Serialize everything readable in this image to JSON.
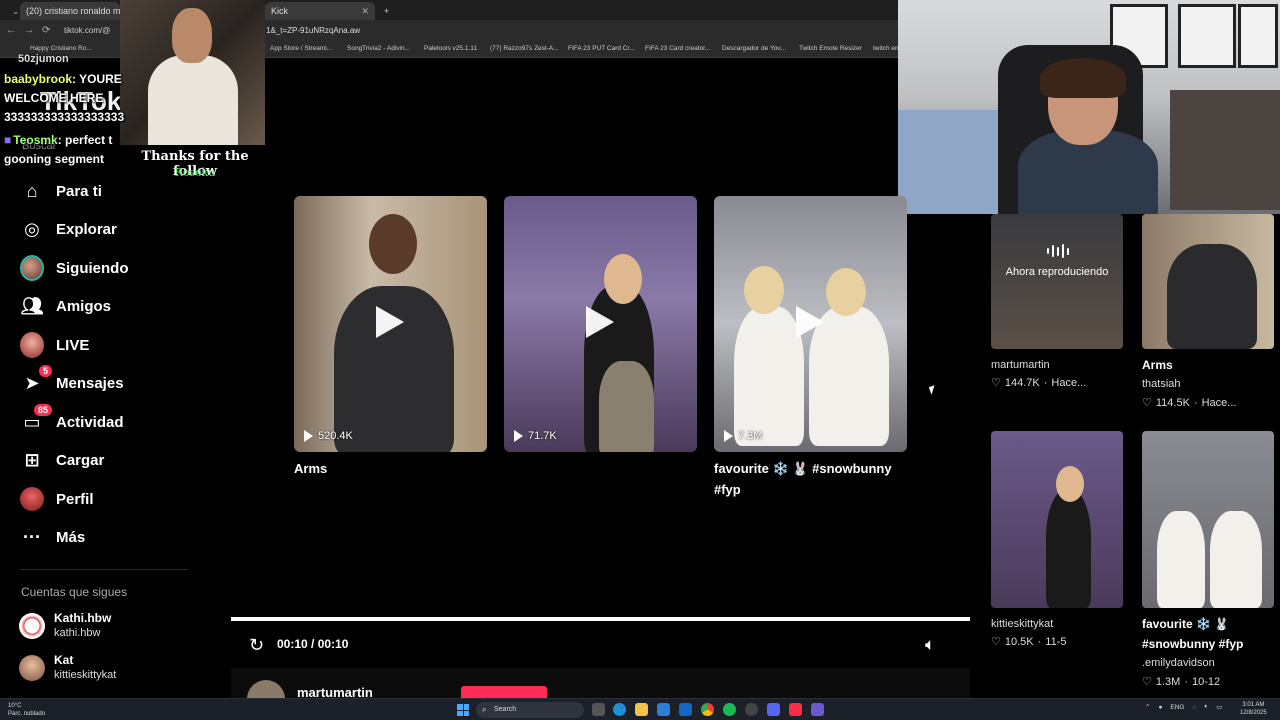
{
  "browser": {
    "tabs": [
      {
        "label": "(20) cristiano ronaldo mexico",
        "active": true
      },
      {
        "label": "Kick",
        "active": false
      }
    ],
    "url_short": "tiktok.com/@",
    "url_tail": "1&_t=ZP-91uNRzqAna.aw",
    "bookmarks": [
      "Happy Cristiano Ro...",
      "App Store / Streami...",
      "SongTrivia2 - Adivin...",
      "Paletools v25.1.11",
      "(77) Razzo97s Zest-A...",
      "FIFA 23 PUT Card Cr...",
      "FIFA 23 Card creator...",
      "Descargador de You...",
      "Twitch Emote Resizer",
      "twitch em"
    ]
  },
  "chat": {
    "top_partial": "50zjumon",
    "messages": [
      {
        "user": "baabybrook",
        "text": ": YOURE"
      },
      {
        "user": "",
        "text": "WELCOME HERE"
      },
      {
        "user": "",
        "text": "333333333333333333"
      },
      {
        "user": "Teosmk",
        "text": ": perfect t"
      },
      {
        "user": "",
        "text": "gooning segment"
      }
    ],
    "follow_text": "Thanks for the follow",
    "follow_name": "Roseku",
    "ghost_logo": "TikTok",
    "ghost_search": "Buscar"
  },
  "sidebar": {
    "items": [
      {
        "label": "Para ti",
        "icon": "home-icon"
      },
      {
        "label": "Explorar",
        "icon": "compass-icon"
      },
      {
        "label": "Siguiendo",
        "icon": "avatar-icon"
      },
      {
        "label": "Amigos",
        "icon": "users-icon"
      },
      {
        "label": "LIVE",
        "icon": "live-icon"
      },
      {
        "label": "Mensajes",
        "icon": "send-icon",
        "badge": "5"
      },
      {
        "label": "Actividad",
        "icon": "inbox-icon",
        "badge": "85"
      },
      {
        "label": "Cargar",
        "icon": "plus-square-icon"
      },
      {
        "label": "Perfil",
        "icon": "profile-icon"
      },
      {
        "label": "Más",
        "icon": "more-icon"
      }
    ],
    "following_title": "Cuentas que sigues",
    "following": [
      {
        "name": "Kathi.hbw",
        "handle": "kathi.hbw"
      },
      {
        "name": "Kat",
        "handle": "kittieskittykat"
      }
    ]
  },
  "grid": {
    "cards": [
      {
        "views": "520.4K",
        "title": "Arms"
      },
      {
        "views": "71.7K",
        "title": ""
      },
      {
        "views": "7.3M",
        "title_line1": "favourite ❄️ 🐰 #snowbunny",
        "title_line2": "#fyp"
      }
    ]
  },
  "player": {
    "time": "00:10 / 00:10",
    "progress": 1.0,
    "next_user": "martumartin"
  },
  "right": {
    "now_playing": "Ahora reproduciendo",
    "items": [
      {
        "title": "",
        "author": "martumartin",
        "likes": "144.7K",
        "date": "Hace..."
      },
      {
        "title": "Arms",
        "author": "thatsiah",
        "likes": "114.5K",
        "date": "Hace..."
      },
      {
        "title": "",
        "author": "kittieskittykat",
        "likes": "10.5K",
        "date": "11-5"
      },
      {
        "title_line1": "favourite ❄️ 🐰",
        "title_line2": "#snowbunny #fyp",
        "author": ".emilydavidson",
        "likes": "1.3M",
        "date": "10-12"
      }
    ]
  },
  "taskbar": {
    "weather_temp": "10°C",
    "weather_desc": "Parc. nublado",
    "search": "Search",
    "lang": "ENG",
    "time": "3:01 AM",
    "date": "12/8/2025"
  },
  "colors": {
    "accent": "#fe2c55",
    "badge": "#fe2c55"
  }
}
